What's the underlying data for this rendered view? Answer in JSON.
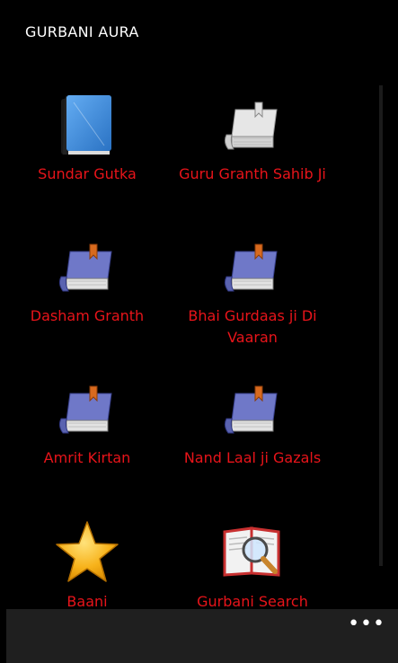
{
  "app": {
    "title": "GURBANI AURA"
  },
  "tiles": [
    {
      "label": "Sundar Gutka",
      "icon": "blue-book-icon"
    },
    {
      "label": "Guru Granth Sahib Ji",
      "icon": "white-book-icon"
    },
    {
      "label": "Dasham Granth",
      "icon": "purple-book-icon"
    },
    {
      "label": "Bhai Gurdaas ji Di Vaaran",
      "icon": "purple-book-icon"
    },
    {
      "label": "Amrit Kirtan",
      "icon": "purple-book-icon"
    },
    {
      "label": "Nand Laal ji Gazals",
      "icon": "purple-book-icon"
    },
    {
      "label": "Baani",
      "icon": "star-icon"
    },
    {
      "label": "Gurbani Search",
      "icon": "book-search-icon"
    }
  ],
  "appbar": {
    "more": "•••"
  },
  "colors": {
    "label": "#e8141a",
    "background": "#000000",
    "appbar": "#1f1f1f"
  }
}
